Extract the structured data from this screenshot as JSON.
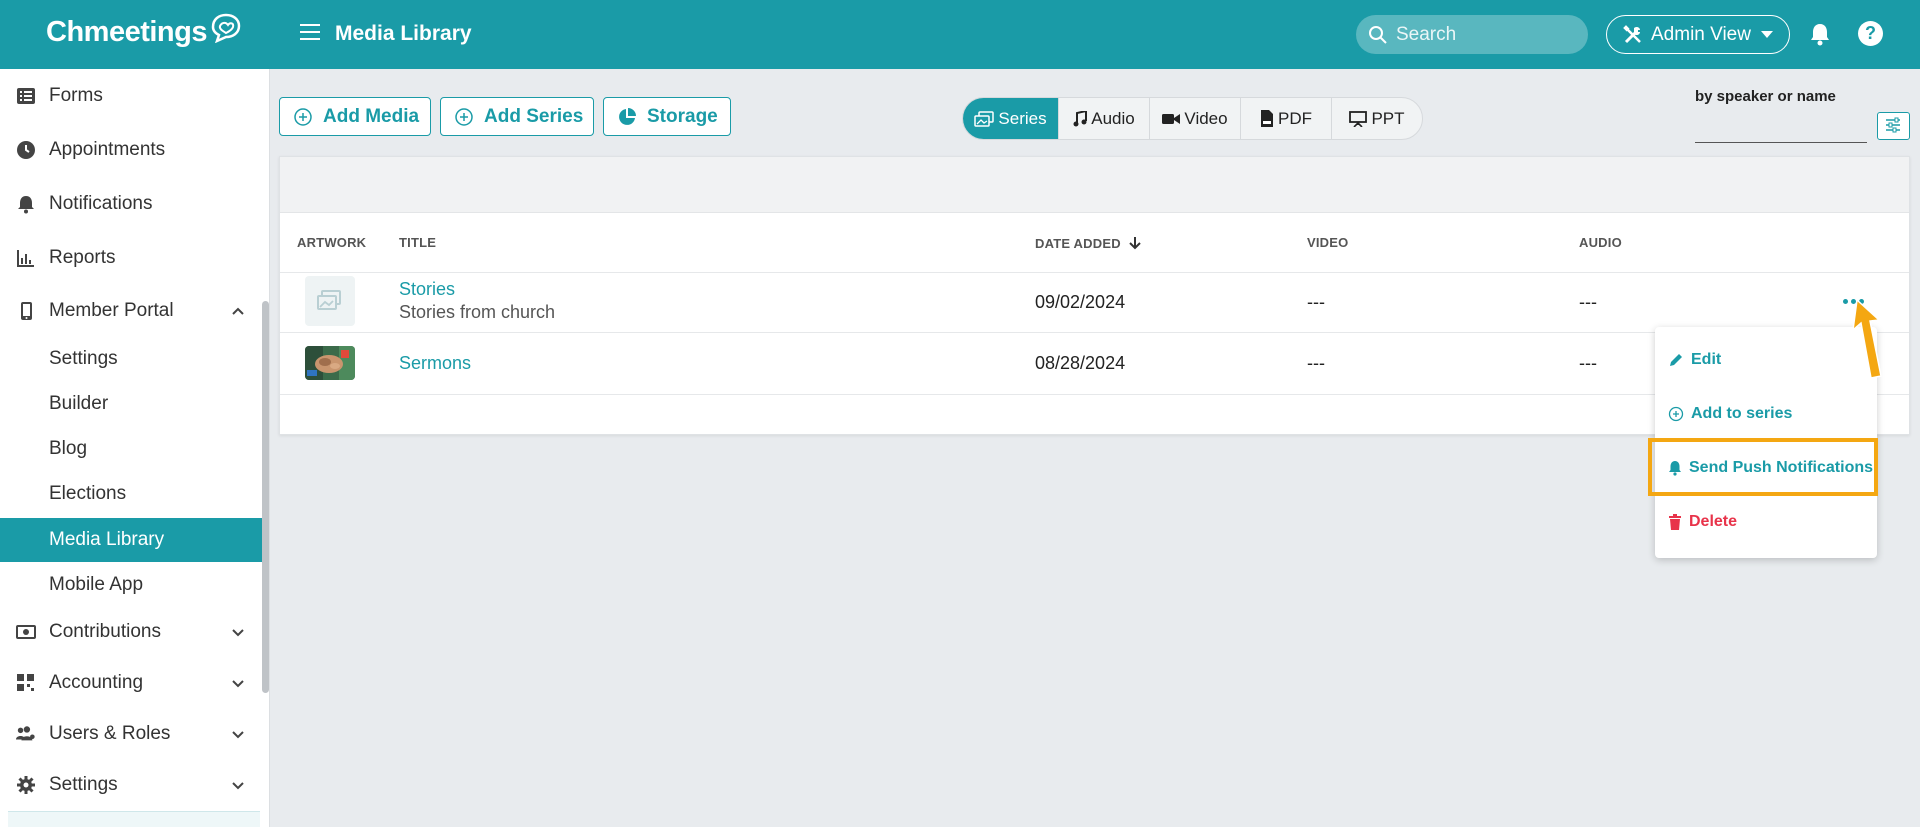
{
  "app": {
    "logo_text": "Chmeetings",
    "page_title": "Media Library",
    "search_placeholder": "Search",
    "admin_view_label": "Admin View",
    "help_label": "?"
  },
  "sidebar": {
    "items": [
      {
        "label": "Forms",
        "icon": "forms-icon"
      },
      {
        "label": "Appointments",
        "icon": "clock-icon"
      },
      {
        "label": "Notifications",
        "icon": "bell-icon"
      },
      {
        "label": "Reports",
        "icon": "chart-icon"
      },
      {
        "label": "Member Portal",
        "icon": "phone-icon",
        "expanded": true
      }
    ],
    "subitems": [
      "Settings",
      "Builder",
      "Blog",
      "Elections",
      "Media Library",
      "Mobile App"
    ],
    "active_subitem": "Media Library",
    "bottom_items": [
      {
        "label": "Contributions",
        "icon": "money-icon"
      },
      {
        "label": "Accounting",
        "icon": "grid-icon"
      },
      {
        "label": "Users & Roles",
        "icon": "users-icon"
      },
      {
        "label": "Settings",
        "icon": "gear-icon"
      }
    ]
  },
  "toolbar": {
    "add_media": "Add Media",
    "add_series": "Add Series",
    "storage": "Storage"
  },
  "tabs": [
    {
      "label": "Series",
      "active": true
    },
    {
      "label": "Audio",
      "active": false
    },
    {
      "label": "Video",
      "active": false
    },
    {
      "label": "PDF",
      "active": false
    },
    {
      "label": "PPT",
      "active": false
    }
  ],
  "filter": {
    "label": "by speaker or name",
    "value": ""
  },
  "table": {
    "columns": [
      "ARTWORK",
      "TITLE",
      "DATE ADDED",
      "VIDEO",
      "AUDIO"
    ],
    "sort_column": "DATE ADDED",
    "sort_direction": "descending",
    "rows": [
      {
        "title": "Stories",
        "subtitle": "Stories from church",
        "date": "09/02/2024",
        "video": "---",
        "audio": "---",
        "artwork": "placeholder"
      },
      {
        "title": "Sermons",
        "subtitle": "",
        "date": "08/28/2024",
        "video": "---",
        "audio": "---",
        "artwork": "photo"
      }
    ]
  },
  "row_menu": {
    "items": [
      {
        "label": "Edit",
        "icon": "pencil-icon"
      },
      {
        "label": "Add to series",
        "icon": "plus-circle-icon"
      },
      {
        "label": "Send Push Notifications",
        "icon": "bell-icon",
        "highlighted": true
      },
      {
        "label": "Delete",
        "icon": "trash-icon",
        "danger": true
      }
    ]
  },
  "colors": {
    "brand": "#1a9ba7",
    "highlight": "#f4a712",
    "danger": "#e8334a"
  }
}
